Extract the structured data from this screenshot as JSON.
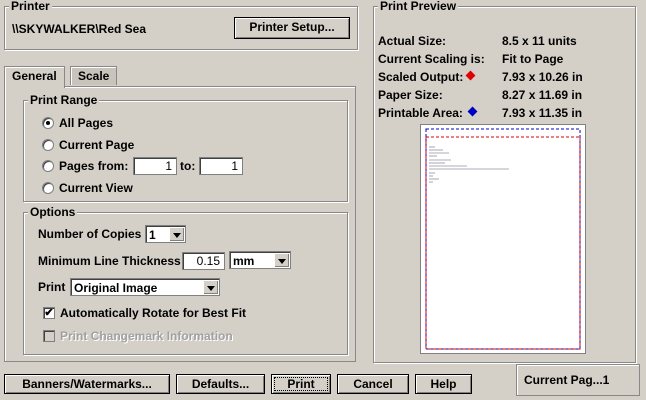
{
  "printer": {
    "legend": "Printer",
    "name": "\\\\SKYWALKER\\Red Sea",
    "setup_button": "Printer Setup..."
  },
  "tabs": [
    {
      "label": "General",
      "active": true
    },
    {
      "label": "Scale",
      "active": false
    }
  ],
  "print_range": {
    "legend": "Print Range",
    "all_pages": "All Pages",
    "current_page": "Current Page",
    "pages_from": "Pages from:",
    "from_value": "1",
    "to_label": "to:",
    "to_value": "1",
    "current_view": "Current View",
    "selected": "all_pages"
  },
  "options": {
    "legend": "Options",
    "copies_label": "Number of Copies",
    "copies_value": "1",
    "line_thickness_label": "Minimum Line Thickness",
    "line_thickness_value": "0.15",
    "unit_value": "mm",
    "print_label": "Print",
    "print_value": "Original Image",
    "auto_rotate": "Automatically Rotate for Best Fit",
    "auto_rotate_checked": true,
    "changemark": "Print Changemark Information",
    "changemark_enabled": false
  },
  "preview": {
    "legend": "Print Preview",
    "actual_size_label": "Actual Size:",
    "actual_size_value": "8.5 x 11 units",
    "scaling_label": "Current Scaling is:",
    "scaling_value": "Fit to Page",
    "scaled_output_label": "Scaled Output:",
    "scaled_output_value": "7.93 x 10.26 in",
    "scaled_output_color": "#e00000",
    "paper_size_label": "Paper Size:",
    "paper_size_value": "8.27 x 11.69 in",
    "printable_area_label": "Printable Area:",
    "printable_area_value": "7.93 x 11.35 in",
    "printable_area_color": "#0000c0"
  },
  "buttons": {
    "banners": "Banners/Watermarks...",
    "defaults": "Defaults...",
    "print": "Print",
    "cancel": "Cancel",
    "help": "Help"
  },
  "status": {
    "text": "Current Pag...1"
  }
}
